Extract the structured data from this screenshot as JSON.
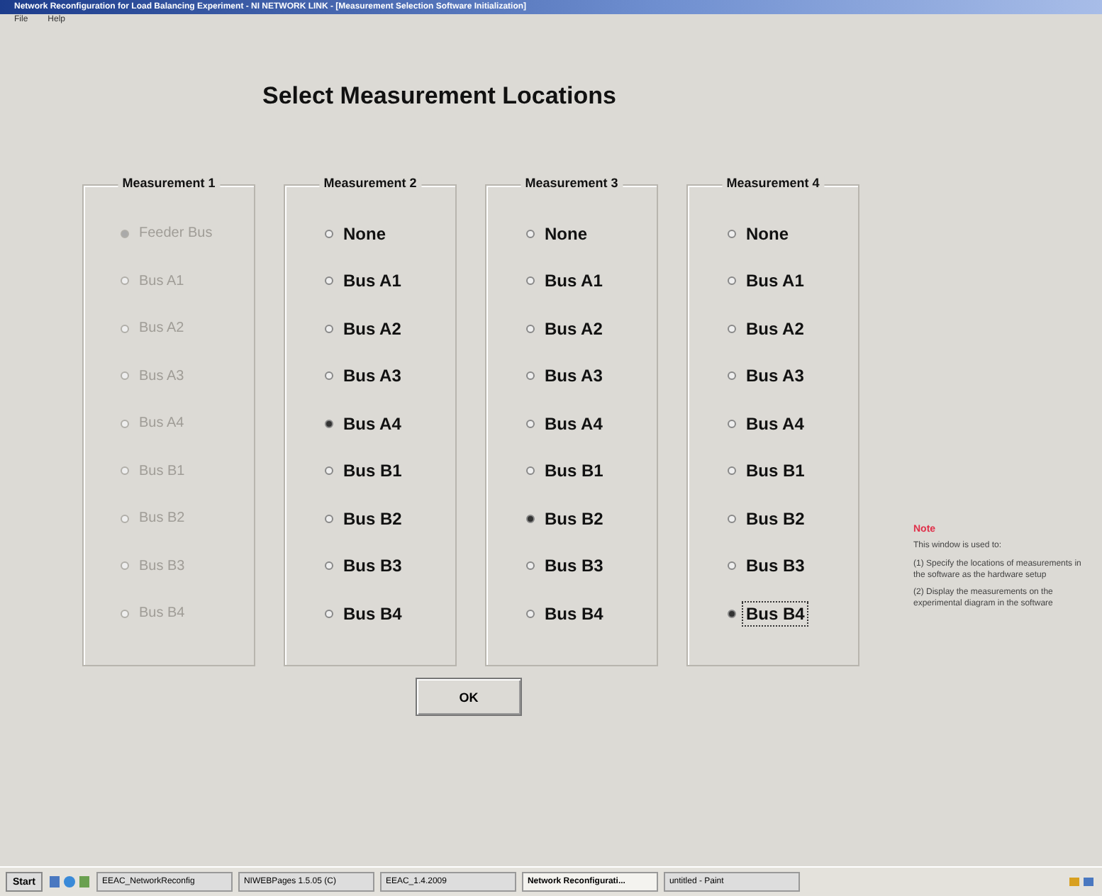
{
  "window": {
    "title": "Network Reconfiguration for Load Balancing Experiment - NI NETWORK LINK - [Measurement Selection Software Initialization]"
  },
  "menu": [
    "File",
    "Help"
  ],
  "heading": "Select Measurement Locations",
  "groups": [
    {
      "title": "Measurement 1",
      "disabled": true,
      "options": [
        {
          "label": "Feeder Bus",
          "selected": true
        },
        {
          "label": "Bus A1",
          "selected": false
        },
        {
          "label": "Bus A2",
          "selected": false
        },
        {
          "label": "Bus A3",
          "selected": false
        },
        {
          "label": "Bus A4",
          "selected": false
        },
        {
          "label": "Bus B1",
          "selected": false
        },
        {
          "label": "Bus B2",
          "selected": false
        },
        {
          "label": "Bus B3",
          "selected": false
        },
        {
          "label": "Bus B4",
          "selected": false
        }
      ]
    },
    {
      "title": "Measurement 2",
      "disabled": false,
      "options": [
        {
          "label": "None",
          "selected": false
        },
        {
          "label": "Bus A1",
          "selected": false
        },
        {
          "label": "Bus A2",
          "selected": false
        },
        {
          "label": "Bus A3",
          "selected": false
        },
        {
          "label": "Bus A4",
          "selected": true
        },
        {
          "label": "Bus B1",
          "selected": false
        },
        {
          "label": "Bus B2",
          "selected": false
        },
        {
          "label": "Bus B3",
          "selected": false
        },
        {
          "label": "Bus B4",
          "selected": false
        }
      ]
    },
    {
      "title": "Measurement 3",
      "disabled": false,
      "options": [
        {
          "label": "None",
          "selected": false
        },
        {
          "label": "Bus A1",
          "selected": false
        },
        {
          "label": "Bus A2",
          "selected": false
        },
        {
          "label": "Bus A3",
          "selected": false
        },
        {
          "label": "Bus A4",
          "selected": false
        },
        {
          "label": "Bus B1",
          "selected": false
        },
        {
          "label": "Bus B2",
          "selected": true
        },
        {
          "label": "Bus B3",
          "selected": false
        },
        {
          "label": "Bus B4",
          "selected": false
        }
      ]
    },
    {
      "title": "Measurement 4",
      "disabled": false,
      "options": [
        {
          "label": "None",
          "selected": false
        },
        {
          "label": "Bus A1",
          "selected": false
        },
        {
          "label": "Bus A2",
          "selected": false
        },
        {
          "label": "Bus A3",
          "selected": false
        },
        {
          "label": "Bus A4",
          "selected": false
        },
        {
          "label": "Bus B1",
          "selected": false
        },
        {
          "label": "Bus B2",
          "selected": false
        },
        {
          "label": "Bus B3",
          "selected": false
        },
        {
          "label": "Bus B4",
          "selected": true
        }
      ]
    }
  ],
  "note": {
    "title": "Note",
    "lines": [
      "This window is used to:",
      "(1) Specify the locations of measurements in the software as the hardware setup",
      "(2) Display the measurements on the experimental diagram in the software"
    ]
  },
  "ok_button": "OK",
  "taskbar": {
    "start": "Start",
    "tasks": [
      {
        "label": "EEAC_NetworkReconfig",
        "selected": false
      },
      {
        "label": "NIWEBPages 1.5.05 (C)",
        "selected": false
      },
      {
        "label": "EEAC_1.4.2009",
        "selected": false
      },
      {
        "label": "Network Reconfigurati...",
        "selected": true
      },
      {
        "label": "untitled - Paint",
        "selected": false
      }
    ]
  }
}
